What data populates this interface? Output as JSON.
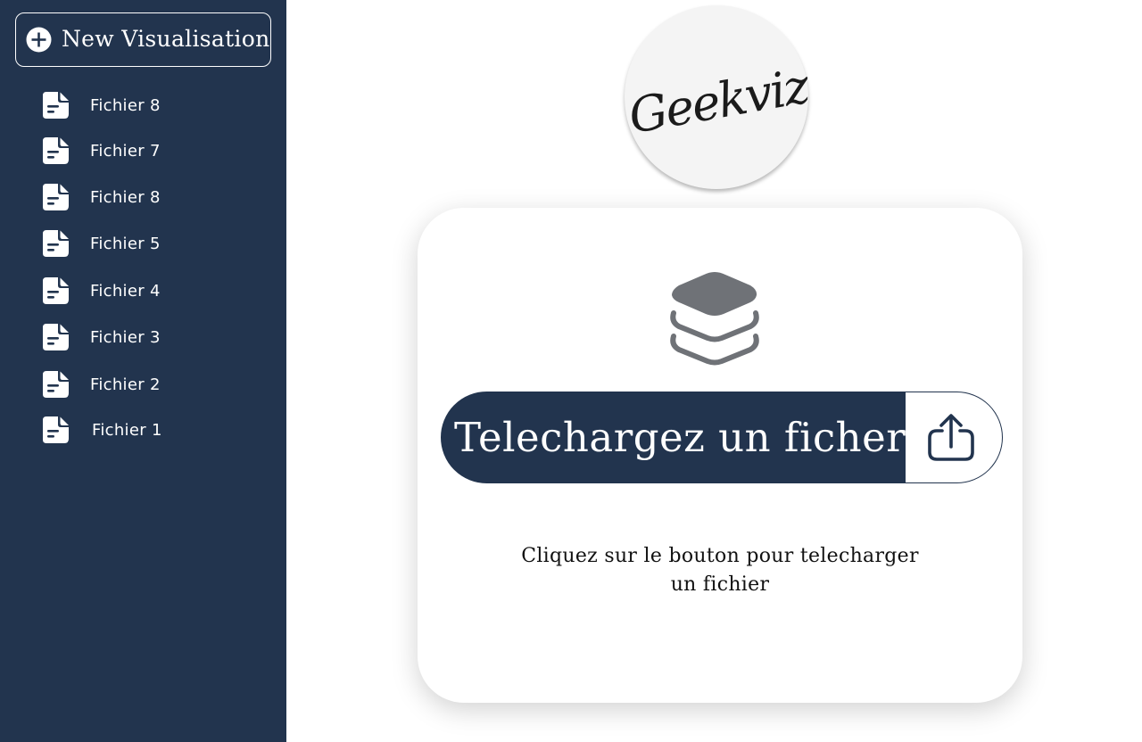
{
  "sidebar": {
    "new_button_label": "New Visualisation",
    "new_button_icon": "plus-circle-icon",
    "items": [
      {
        "label": "Fichier 8",
        "icon": "document-icon"
      },
      {
        "label": "Fichier 7",
        "icon": "document-icon"
      },
      {
        "label": "Fichier 8",
        "icon": "document-icon"
      },
      {
        "label": "Fichier 5",
        "icon": "document-icon"
      },
      {
        "label": "Fichier 4",
        "icon": "document-icon"
      },
      {
        "label": "Fichier 3",
        "icon": "document-icon"
      },
      {
        "label": "Fichier 2",
        "icon": "document-icon"
      },
      {
        "label": "Fichier 1",
        "icon": "document-icon"
      }
    ]
  },
  "logo": {
    "text": "Geekviz"
  },
  "upload": {
    "icon": "layers-icon",
    "bar_label": "Telechargez un ficher",
    "button_icon": "upload-share-icon",
    "hint": "Cliquez sur le bouton pour telecharger un fichier"
  },
  "colors": {
    "sidebar_bg": "#22344e",
    "accent": "#22344e",
    "icon_gray": "#6f7277",
    "logo_bg": "#f4f4f4",
    "white": "#ffffff"
  }
}
